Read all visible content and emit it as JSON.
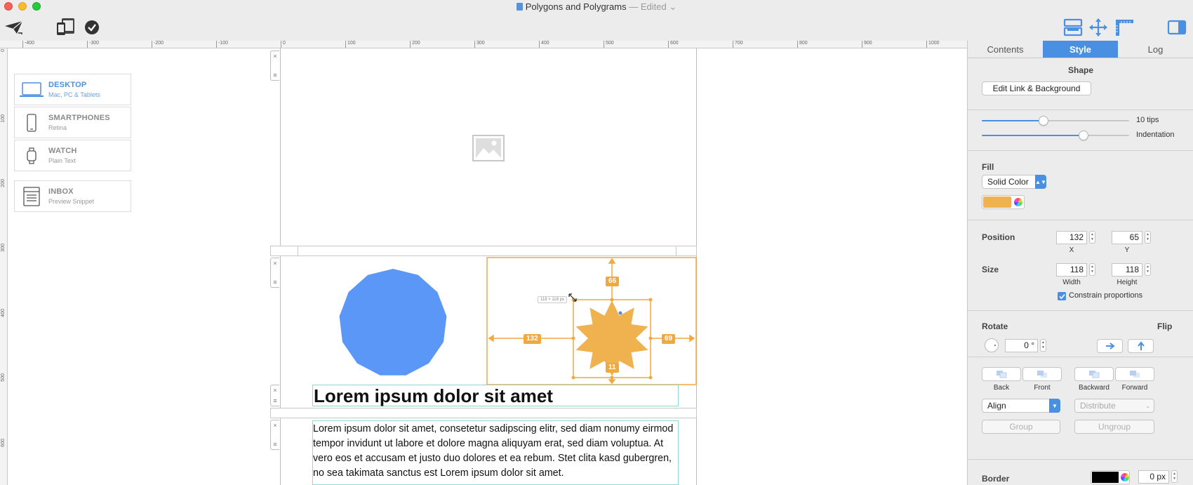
{
  "window": {
    "title": "Polygons and Polygrams",
    "edited_label": "— Edited",
    "edited_chevron": "⌄"
  },
  "ruler": {
    "top_ticks": [
      "-400",
      "-300",
      "-200",
      "-100",
      "0",
      "100",
      "200",
      "300",
      "400",
      "500",
      "600",
      "700",
      "800",
      "900",
      "1000"
    ],
    "left_ticks": [
      "0",
      "100",
      "200",
      "300",
      "400",
      "500",
      "600"
    ]
  },
  "devices": [
    {
      "name": "DESKTOP",
      "sub": "Mac, PC & Tablets",
      "active": true
    },
    {
      "name": "SMARTPHONES",
      "sub": "Retina",
      "active": false
    },
    {
      "name": "WATCH",
      "sub": "Plain Text",
      "active": false
    },
    {
      "name": "INBOX",
      "sub": "Preview Snippet",
      "active": false
    }
  ],
  "canvas": {
    "handle_close": "×",
    "handle_grip": "≡",
    "heading": "Lorem ipsum dolor sit amet",
    "body": "Lorem ipsum dolor sit amet, consetetur sadipscing elitr, sed diam nonumy eirmod tempor invidunt ut labore et dolore magna aliquyam erat, sed diam voluptua. At vero eos et accusam et justo duo dolores et ea rebum. Stet clita kasd gubergren, no sea takimata sanctus est Lorem ipsum dolor sit amet.",
    "size_tooltip": "118 × 118 px",
    "measure_top": "66",
    "measure_left": "132",
    "measure_right": "69",
    "measure_bottom": "11",
    "polygon_color": "#5b97f7",
    "star_color": "#f0b14f",
    "selection_color": "#f0a941"
  },
  "panel": {
    "tabs": [
      {
        "label": "Contents",
        "active": false
      },
      {
        "label": "Style",
        "active": true
      },
      {
        "label": "Log",
        "active": false
      }
    ],
    "shape_title": "Shape",
    "edit_link_label": "Edit Link & Background",
    "tips_label": "10 tips",
    "indentation_label": "Indentation",
    "tips_value": 0.42,
    "indentation_value": 0.69,
    "fill_label": "Fill",
    "fill_type": "Solid Color",
    "fill_color": "#f0b14f",
    "position_label": "Position",
    "pos_x": "132",
    "pos_y": "65",
    "x_caption": "X",
    "y_caption": "Y",
    "size_label": "Size",
    "width": "118",
    "height": "118",
    "width_caption": "Width",
    "height_caption": "Height",
    "constrain_label": "Constrain proportions",
    "rotate_label": "Rotate",
    "rotate_value": "0 °",
    "flip_label": "Flip",
    "back_label": "Back",
    "front_label": "Front",
    "backward_label": "Backward",
    "forward_label": "Forward",
    "align_label": "Align",
    "distribute_label": "Distribute",
    "group_label": "Group",
    "ungroup_label": "Ungroup",
    "border_label": "Border",
    "border_color": "#000000",
    "border_width": "0 px"
  }
}
